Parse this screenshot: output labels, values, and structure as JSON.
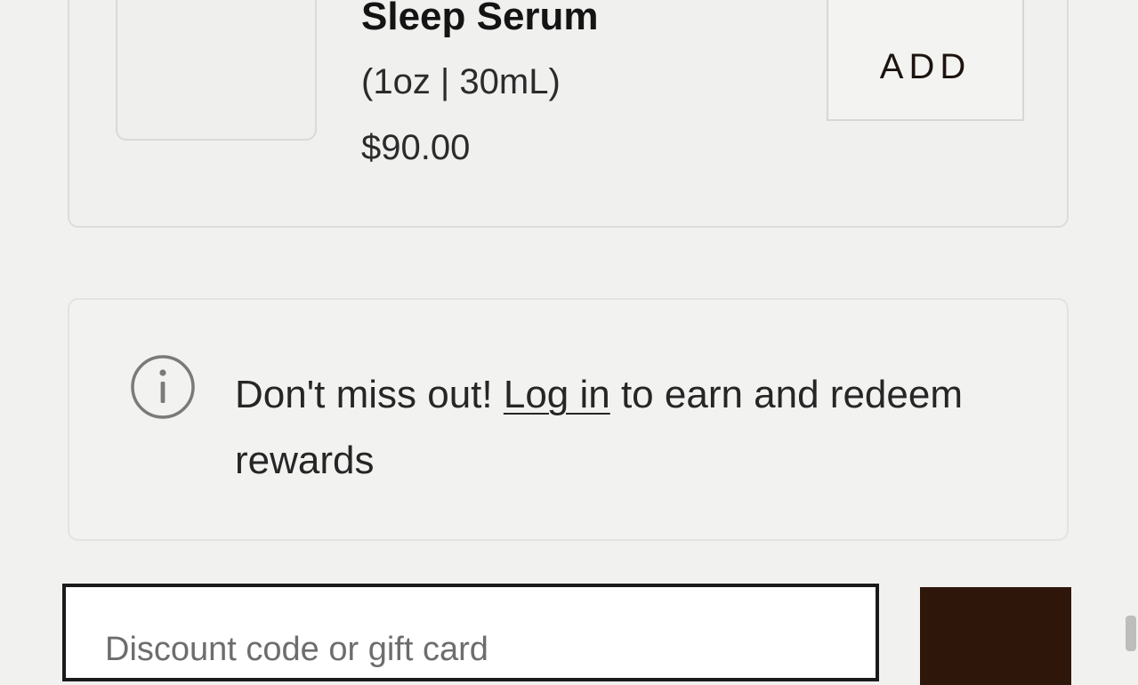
{
  "upsell": {
    "product_name": "Sleep Serum",
    "product_size": "(1oz | 30mL)",
    "product_price": "$90.00",
    "add_label": "ADD"
  },
  "notice": {
    "text_before": "Don't miss out! ",
    "link_label": "Log in",
    "text_after": " to earn and redeem rewards",
    "icon": "info-icon"
  },
  "discount": {
    "placeholder": "Discount code or gift card",
    "value": ""
  },
  "colors": {
    "background": "#f1f1f0",
    "apply_button": "#2e160b",
    "input_border": "#1a1a1a"
  }
}
